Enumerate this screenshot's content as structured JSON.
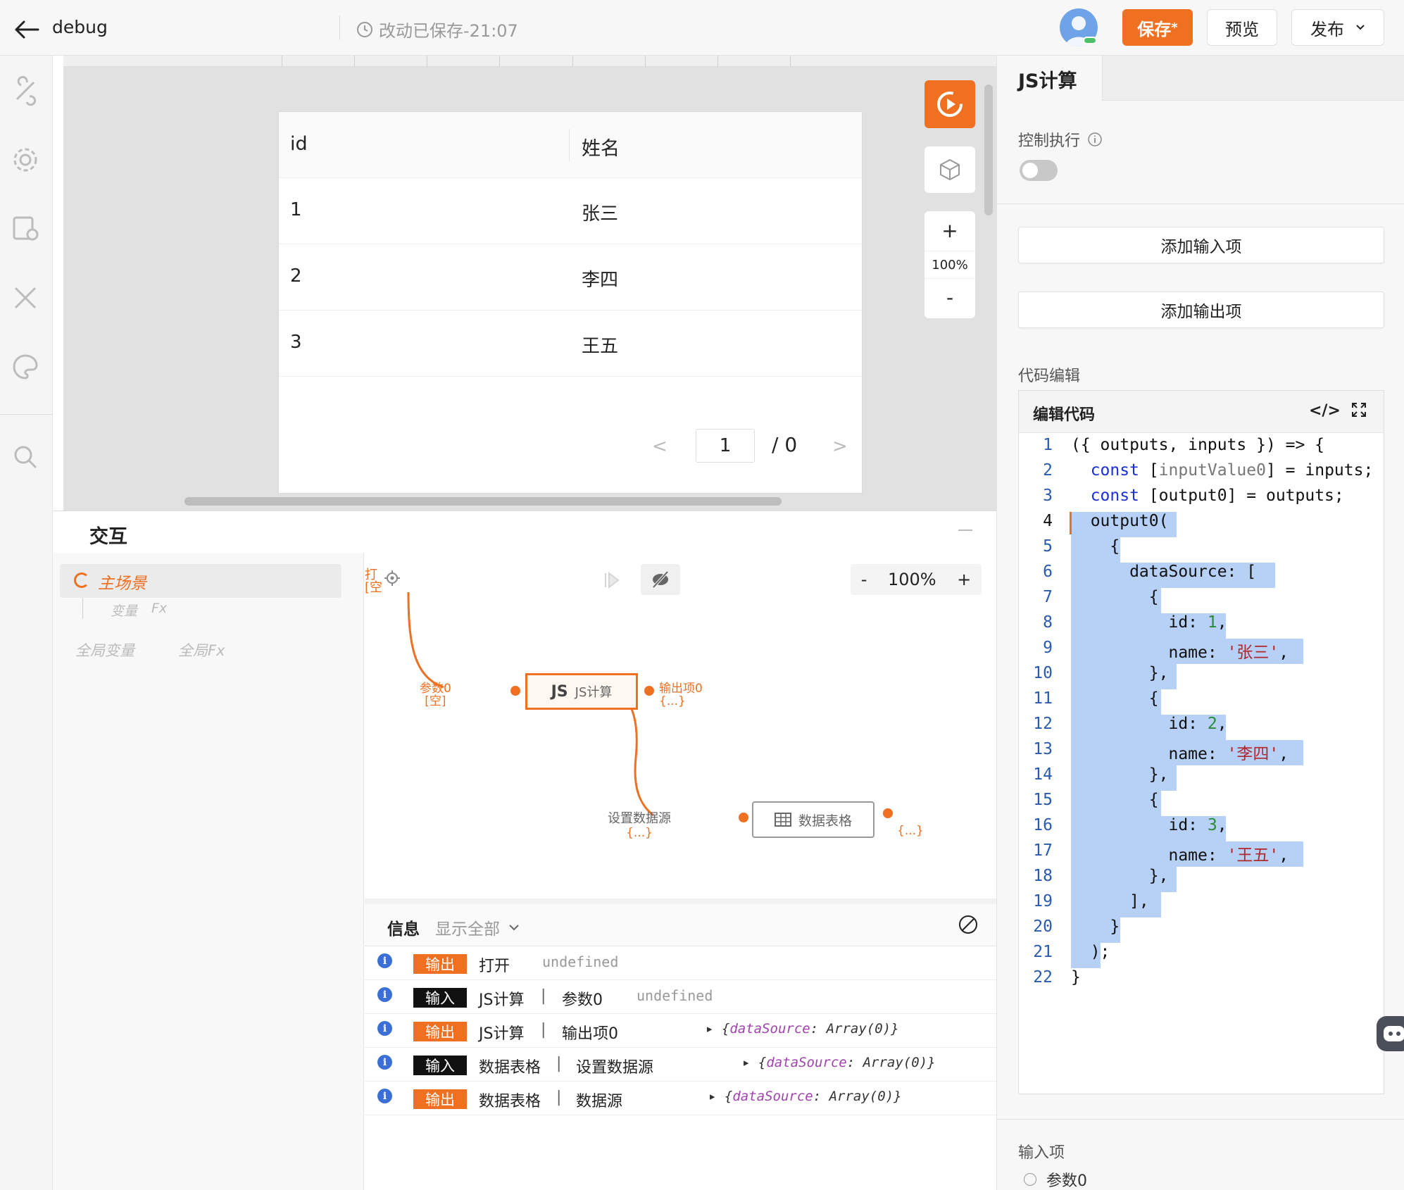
{
  "header": {
    "title": "debug",
    "save_status": "改动已保存-21:07",
    "save_label": "保存",
    "save_dirty_mark": "*",
    "preview_label": "预览",
    "publish_label": "发布"
  },
  "canvas": {
    "zoom_in": "+",
    "zoom_level": "100%",
    "zoom_out": "-",
    "table": {
      "columns": [
        "id",
        "姓名"
      ],
      "rows": [
        {
          "id": "1",
          "name": "张三"
        },
        {
          "id": "2",
          "name": "李四"
        },
        {
          "id": "3",
          "name": "王五"
        }
      ],
      "pager": {
        "prev": "<",
        "current": "1",
        "total": "/ 0",
        "next": ">"
      }
    }
  },
  "interaction": {
    "title": "交互",
    "main_scene": "主场景",
    "scene_var": "变量",
    "scene_fx": "Fx",
    "global_var": "全局变量",
    "global_fx": "全局Fx",
    "flow": {
      "zoom_minus": "-",
      "zoom_level": "100%",
      "zoom_plus": "+",
      "start_label_1": "打",
      "start_label_2": "[空",
      "js_node_badge": "JS",
      "js_node_label": "JS计算",
      "js_in_port": "参数0",
      "js_in_value": "[空]",
      "js_out_port": "输出项0",
      "js_out_value": "{...}",
      "table_in_port": "设置数据源",
      "table_in_value": "{...}",
      "table_node_label": "数据表格",
      "table_out_value": "{...}"
    },
    "info": {
      "title": "信息",
      "filter": "显示全部",
      "rows": [
        {
          "tag": "输出",
          "kind": "out",
          "target": "打开",
          "sep": "",
          "port": "",
          "value": "undefined"
        },
        {
          "tag": "输入",
          "kind": "in",
          "target": "JS计算",
          "sep": "|",
          "port": "参数0",
          "value": "undefined"
        },
        {
          "tag": "输出",
          "kind": "out",
          "target": "JS计算",
          "sep": "|",
          "port": "输出项0",
          "obj_key": "dataSource",
          "obj_val": "Array(0)"
        },
        {
          "tag": "输入",
          "kind": "in",
          "target": "数据表格",
          "sep": "|",
          "port": "设置数据源",
          "obj_key": "dataSource",
          "obj_val": "Array(0)"
        },
        {
          "tag": "输出",
          "kind": "out",
          "target": "数据表格",
          "sep": "|",
          "port": "数据源",
          "obj_key": "dataSource",
          "obj_val": "Array(0)"
        }
      ]
    }
  },
  "right_panel": {
    "tab": "JS计算",
    "control_exec": "控制执行",
    "add_input": "添加输入项",
    "add_output": "添加输出项",
    "code_section": "代码编辑",
    "code_title": "编辑代码",
    "code_toggle": "</>",
    "input_items": "输入项",
    "param0": "参数0"
  },
  "colors": {
    "accent": "#f07022",
    "selection": "#b7d1f6",
    "keyword": "#1a2ed6",
    "string": "#b0272d",
    "number": "#2a8a3a"
  }
}
